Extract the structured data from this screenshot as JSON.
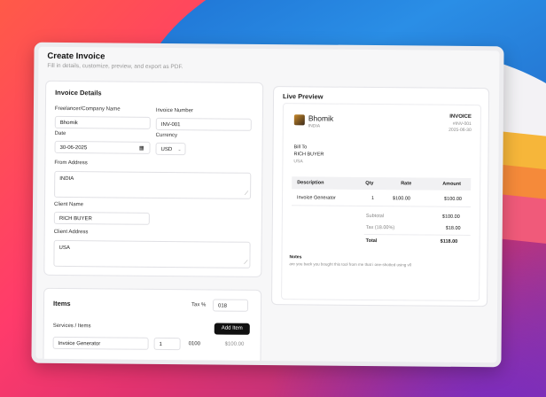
{
  "app": {
    "title": "Create Invoice",
    "subtitle": "Fill in details, customize, preview, and export as PDF."
  },
  "details": {
    "heading": "Invoice Details",
    "company_label": "Freelancer/Company Name",
    "company_value": "Bhomik",
    "invoice_number_label": "Invoice Number",
    "invoice_number_value": "INV-001",
    "date_label": "Date",
    "date_value": "30-06-2025",
    "currency_label": "Currency",
    "currency_value": "USD",
    "from_address_label": "From Address",
    "from_address_value": "INDIA",
    "client_name_label": "Client Name",
    "client_name_value": "RICH BUYER",
    "client_address_label": "Client Address",
    "client_address_value": "USA"
  },
  "items": {
    "heading": "Items",
    "tax_label": "Tax %",
    "tax_value": "018",
    "services_label": "Services / Items",
    "add_button": "Add Item",
    "rows": [
      {
        "description": "Invoice Generator",
        "qty": "1",
        "rate": "0100",
        "amount": "$100.00"
      }
    ]
  },
  "preview": {
    "heading": "Live Preview",
    "company": "Bhomik",
    "company_address": "INDIA",
    "doc_title": "INVOICE",
    "doc_number": "#INV-001",
    "doc_date": "2025-06-30",
    "bill_to_label": "Bill To",
    "bill_to_name": "RICH BUYER",
    "bill_to_address": "USA",
    "columns": [
      "Description",
      "Qty",
      "Rate",
      "Amount"
    ],
    "rows": [
      {
        "description": "Invoice Generator",
        "qty": "1",
        "rate": "$100.00",
        "amount": "$100.00"
      }
    ],
    "subtotal_label": "Subtotal",
    "subtotal_value": "$100.00",
    "tax_label": "Tax (18.00%)",
    "tax_value": "$18.00",
    "total_label": "Total",
    "total_value": "$118.00",
    "notes_label": "Notes",
    "notes_text": "are you back you bought this tool from me that i one-shotted using v0"
  },
  "colors": {
    "accent": "#111111",
    "muted": "#888888",
    "card_border": "#e4e4e8"
  }
}
